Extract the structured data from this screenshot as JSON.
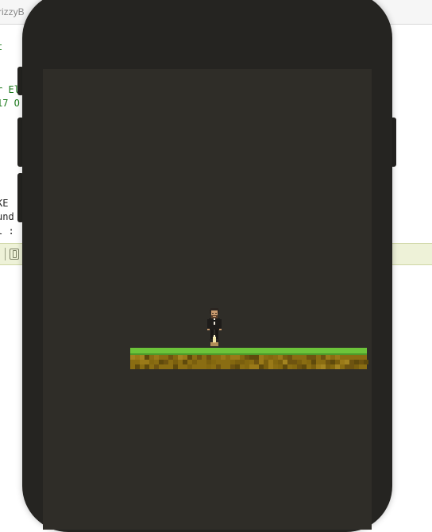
{
  "editor": {
    "tab_label": "rizzyB",
    "code_lines": [
      {
        "text": "t",
        "tone": "green"
      },
      {
        "text": "r El",
        "tone": "green"
      },
      {
        "text": "17 O",
        "tone": "green"
      },
      {
        "text": "KE",
        "tone": "black"
      },
      {
        "text": "und",
        "tone": "black"
      },
      {
        "text": "l :",
        "tone": "black"
      }
    ]
  },
  "colors": {
    "device_frame": "#252421",
    "screen_background": "#2f2d28",
    "grass": "#6cc43a",
    "dirt": "#8a6d12",
    "debug_bar": "#eef2d8"
  },
  "game": {
    "player_icon": "pixel-character-sprite",
    "platform_icon": "grass-dirt-platform"
  }
}
